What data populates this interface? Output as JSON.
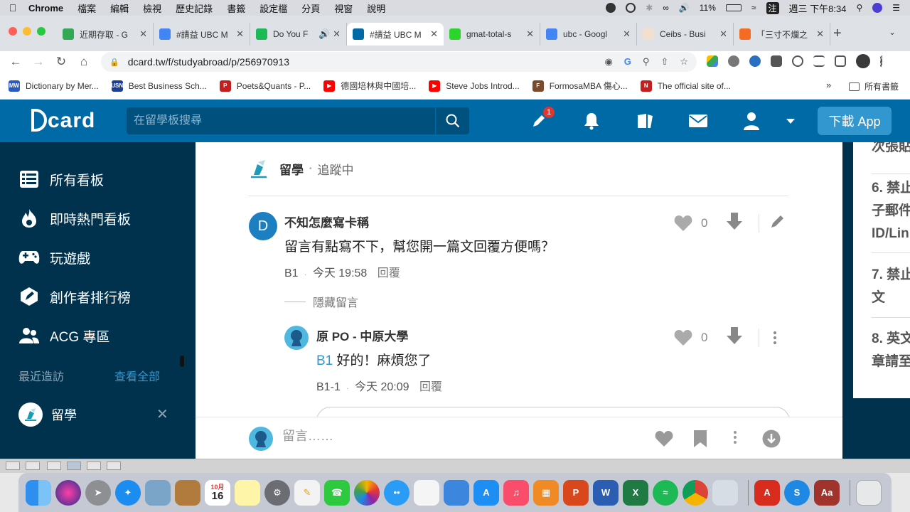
{
  "menubar": {
    "app": "Chrome",
    "items": [
      "檔案",
      "編輯",
      "檢視",
      "歷史記錄",
      "書籤",
      "設定檔",
      "分頁",
      "視窗",
      "說明"
    ],
    "battery": "11%",
    "input_method": "注",
    "clock": "週三 下午8:34"
  },
  "tabs": [
    {
      "title": "近期存取 - G",
      "fav": "drive",
      "color": "#34a853"
    },
    {
      "title": "#請益 UBC M",
      "fav": "doc",
      "color": "#4285f4"
    },
    {
      "title": "Do You F",
      "fav": "spotify",
      "color": "#1db954"
    },
    {
      "title": "#請益 UBC M",
      "fav": "dcard",
      "color": "#006aa6"
    },
    {
      "title": "gmat-total-s",
      "fav": "green",
      "color": "#2bd52b"
    },
    {
      "title": "ubc - Googl",
      "fav": "google",
      "color": "#4285f4"
    },
    {
      "title": "Ceibs - Busi",
      "fav": "ft",
      "color": "#f2dfce"
    },
    {
      "title": "「三寸不爛之",
      "fav": "orange",
      "color": "#f36c22"
    }
  ],
  "address": {
    "url": "dcard.tw/f/studyabroad/p/256970913"
  },
  "bookmarks": [
    {
      "label": "Dictionary by Mer...",
      "color": "#2b59c3",
      "short": "MW"
    },
    {
      "label": "Best Business Sch...",
      "color": "#1c3f94",
      "short": "USN"
    },
    {
      "label": "Poets&Quants - P...",
      "color": "#c41e1e",
      "short": "P"
    },
    {
      "label": "德國培林與中國培...",
      "color": "#ff0000",
      "short": "▶"
    },
    {
      "label": "Steve Jobs Introd...",
      "color": "#ff0000",
      "short": "▶"
    },
    {
      "label": "FormosaMBA 傷心...",
      "color": "#7a4a2a",
      "short": "F"
    },
    {
      "label": "The official site of...",
      "color": "#c41e1e",
      "short": "N"
    }
  ],
  "bookmarks_all": "所有書籤",
  "dcard": {
    "logo": "card",
    "search_placeholder": "在留學板搜尋",
    "notif_badge": "1",
    "download_app": "下載 App"
  },
  "sidebar": {
    "items": [
      {
        "label": "所有看板",
        "icon": "list-icon"
      },
      {
        "label": "即時熱門看板",
        "icon": "fire-icon"
      },
      {
        "label": "玩遊戲",
        "icon": "gamepad-icon"
      },
      {
        "label": "創作者排行榜",
        "icon": "creator-icon"
      },
      {
        "label": "ACG 專區",
        "icon": "people-icon"
      }
    ],
    "recent_label": "最近造訪",
    "recent_all": "查看全部",
    "recent_board": "留學"
  },
  "post": {
    "board": "留學",
    "following": "追蹤中"
  },
  "comments": [
    {
      "avatar_letter": "D",
      "author": "不知怎麼寫卡稱",
      "text": "留言有點寫不下，幫您開一篇文回覆方便嗎？",
      "floor": "B1",
      "time": "今天 19:58",
      "reply": "回覆",
      "likes": "0"
    }
  ],
  "hidden_label": "隱藏留言",
  "reply": {
    "author": "原 PO - 中原大學",
    "ref": "B1",
    "text": "好的！麻煩您了",
    "floor": "B1-1",
    "time": "今天 20:09",
    "reply": "回覆",
    "likes": "0"
  },
  "bottombar": {
    "placeholder": "留言……"
  },
  "rules_panel": {
    "top_fragment": "次張貼",
    "r6a": "6. 禁止",
    "r6b": "子郵件",
    "r6c": "ID/Lin",
    "r7a": "7. 禁止",
    "r7b": "文",
    "r8a": "8. 英文",
    "r8b": "章請至"
  },
  "dock": {
    "calendar_month": "10月",
    "calendar_day": "16"
  }
}
